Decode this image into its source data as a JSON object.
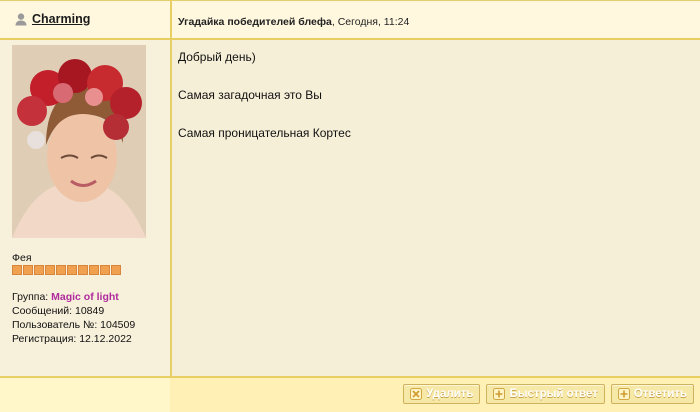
{
  "post": {
    "author": {
      "name": "Charming",
      "icon": "user-icon"
    },
    "topic": {
      "title": "Угадайка победителей блефа",
      "sep": ", ",
      "time": "Сегодня, 11:24"
    },
    "profile": {
      "rank": "Фея",
      "stars": 10,
      "group_label": "Группа: ",
      "group_value": "Magic of light",
      "messages": "Сообщений: 10849",
      "user_no": "Пользователь №: 104509",
      "registered": "Регистрация: 12.12.2022"
    },
    "message_lines": [
      "Добрый день)",
      "Самая загадочная это Вы",
      "Самая проницательная Кортес"
    ],
    "actions": [
      {
        "label": "Удалить",
        "icon": "x-icon"
      },
      {
        "label": "Быстрый ответ",
        "icon": "plus-icon"
      },
      {
        "label": "Ответить",
        "icon": "plus-icon"
      }
    ]
  },
  "colors": {
    "border": "#e7cf63",
    "group": "#b02b9e",
    "star": "#f0a14f"
  }
}
